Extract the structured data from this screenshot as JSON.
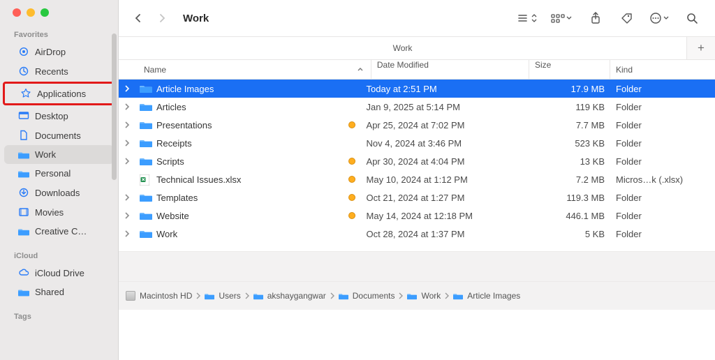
{
  "window": {
    "title": "Work"
  },
  "sidebar": {
    "sections": {
      "favorites": "Favorites",
      "icloud": "iCloud",
      "tags": "Tags"
    },
    "items": [
      {
        "label": "AirDrop",
        "icon": "airdrop"
      },
      {
        "label": "Recents",
        "icon": "clock"
      },
      {
        "label": "Applications",
        "icon": "app-store",
        "highlighted": true
      },
      {
        "label": "Desktop",
        "icon": "desktop"
      },
      {
        "label": "Documents",
        "icon": "document"
      },
      {
        "label": "Work",
        "icon": "folder",
        "active": true
      },
      {
        "label": "Personal",
        "icon": "folder"
      },
      {
        "label": "Downloads",
        "icon": "download"
      },
      {
        "label": "Movies",
        "icon": "movies"
      },
      {
        "label": "Creative C…",
        "icon": "folder"
      }
    ],
    "icloud_items": [
      {
        "label": "iCloud Drive",
        "icon": "cloud"
      },
      {
        "label": "Shared",
        "icon": "shared"
      }
    ]
  },
  "tabs": {
    "current": "Work"
  },
  "columns": {
    "name": "Name",
    "date": "Date Modified",
    "size": "Size",
    "kind": "Kind"
  },
  "rows": [
    {
      "name": "Article Images",
      "type": "folder",
      "expander": true,
      "selected": true,
      "tag": false,
      "date": "Today at 2:51 PM",
      "size": "17.9 MB",
      "kind": "Folder"
    },
    {
      "name": "Articles",
      "type": "folder",
      "expander": true,
      "tag": false,
      "date": "Jan 9, 2025 at 5:14 PM",
      "size": "119 KB",
      "kind": "Folder"
    },
    {
      "name": "Presentations",
      "type": "folder",
      "expander": true,
      "tag": true,
      "date": "Apr 25, 2024 at 7:02 PM",
      "size": "7.7 MB",
      "kind": "Folder"
    },
    {
      "name": "Receipts",
      "type": "folder",
      "expander": true,
      "tag": false,
      "date": "Nov 4, 2024 at 3:46 PM",
      "size": "523 KB",
      "kind": "Folder"
    },
    {
      "name": "Scripts",
      "type": "folder",
      "expander": true,
      "tag": true,
      "date": "Apr 30, 2024 at 4:04 PM",
      "size": "13 KB",
      "kind": "Folder"
    },
    {
      "name": "Technical Issues.xlsx",
      "type": "xlsx",
      "expander": false,
      "tag": true,
      "date": "May 10, 2024 at 1:12 PM",
      "size": "7.2 MB",
      "kind": "Micros…k (.xlsx)"
    },
    {
      "name": "Templates",
      "type": "folder",
      "expander": true,
      "tag": true,
      "date": "Oct 21, 2024 at 1:27 PM",
      "size": "119.3 MB",
      "kind": "Folder"
    },
    {
      "name": "Website",
      "type": "folder",
      "expander": true,
      "tag": true,
      "date": "May 14, 2024 at 12:18 PM",
      "size": "446.1 MB",
      "kind": "Folder"
    },
    {
      "name": "Work",
      "type": "folder",
      "expander": true,
      "tag": false,
      "date": "Oct 28, 2024 at 1:37 PM",
      "size": "5 KB",
      "kind": "Folder"
    }
  ],
  "path": [
    {
      "label": "Macintosh HD",
      "icon": "disk"
    },
    {
      "label": "Users",
      "icon": "folder"
    },
    {
      "label": "akshaygangwar",
      "icon": "folder"
    },
    {
      "label": "Documents",
      "icon": "folder"
    },
    {
      "label": "Work",
      "icon": "folder"
    },
    {
      "label": "Article Images",
      "icon": "folder"
    }
  ]
}
